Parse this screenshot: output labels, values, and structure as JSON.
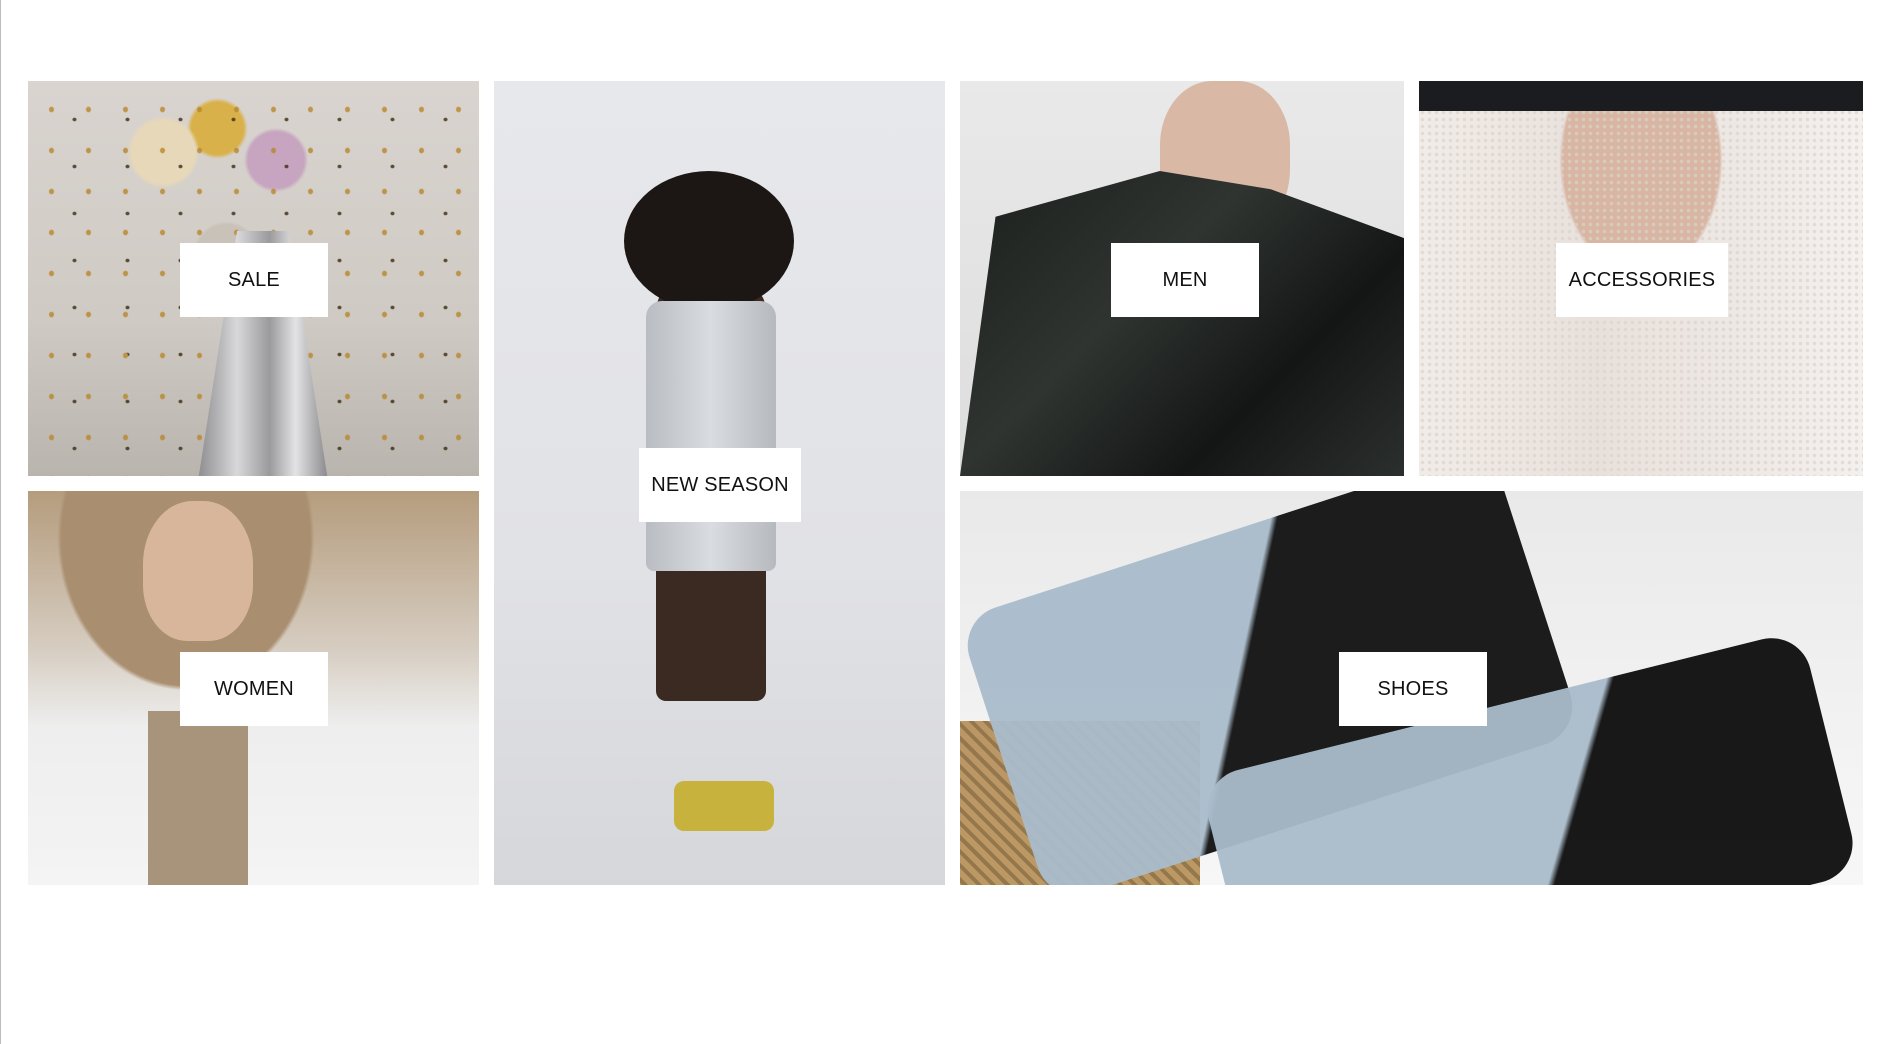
{
  "categories": {
    "sale": {
      "label": "SALE"
    },
    "women": {
      "label": "WOMEN"
    },
    "new_season": {
      "label": "NEW SEASON"
    },
    "men": {
      "label": "MEN"
    },
    "accessories": {
      "label": "ACCESSORIES"
    },
    "shoes": {
      "label": "SHOES"
    }
  }
}
